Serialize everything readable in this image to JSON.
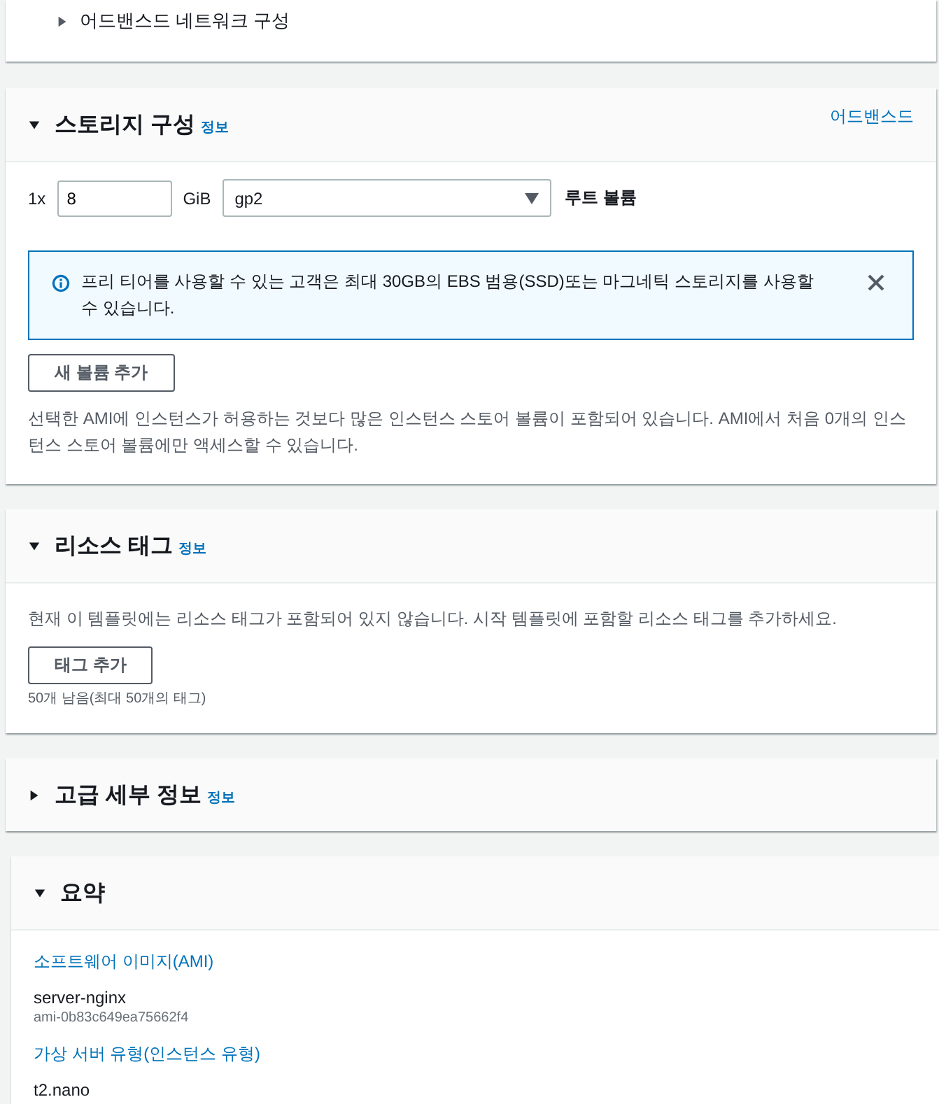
{
  "network_panel": {
    "expander": {
      "label": "어드밴스드 네트워크 구성",
      "expanded": false
    }
  },
  "storage": {
    "title": "스토리지 구성",
    "expanded": true,
    "info": "정보",
    "advanced_link": "어드밴스드",
    "volume": {
      "count": "1x",
      "size": "8",
      "unit": "GiB",
      "type": "gp2",
      "label": "루트 볼륨"
    },
    "alert": {
      "text": "프리 티어를 사용할 수 있는 고객은 최대 30GB의 EBS 범용(SSD)또는 마그네틱 스토리지를 사용할 수 있습니다."
    },
    "add_button": "새 볼륨 추가",
    "note": "선택한 AMI에 인스턴스가 허용하는 것보다 많은 인스턴스 스토어 볼륨이 포함되어 있습니다. AMI에서 처음 0개의 인스턴스 스토어 볼륨에만 액세스할 수 있습니다."
  },
  "resource_tags": {
    "title": "리소스 태그",
    "expanded": true,
    "info": "정보",
    "description": "현재 이 템플릿에는 리소스 태그가 포함되어 있지 않습니다. 시작 템플릿에 포함할 리소스 태그를 추가하세요.",
    "add_button": "태그 추가",
    "hint": "50개 남음(최대 50개의 태그)"
  },
  "advanced_details": {
    "title": "고급 세부 정보",
    "expanded": false,
    "info": "정보"
  },
  "summary": {
    "title": "요약",
    "expanded": true,
    "items": [
      {
        "label": "소프트웨어 이미지(AMI)",
        "value": "server-nginx",
        "sub": "ami-0b83c649ea75662f4"
      },
      {
        "label": "가상 서버 유형(인스턴스 유형)",
        "value": "t2.nano"
      }
    ]
  }
}
